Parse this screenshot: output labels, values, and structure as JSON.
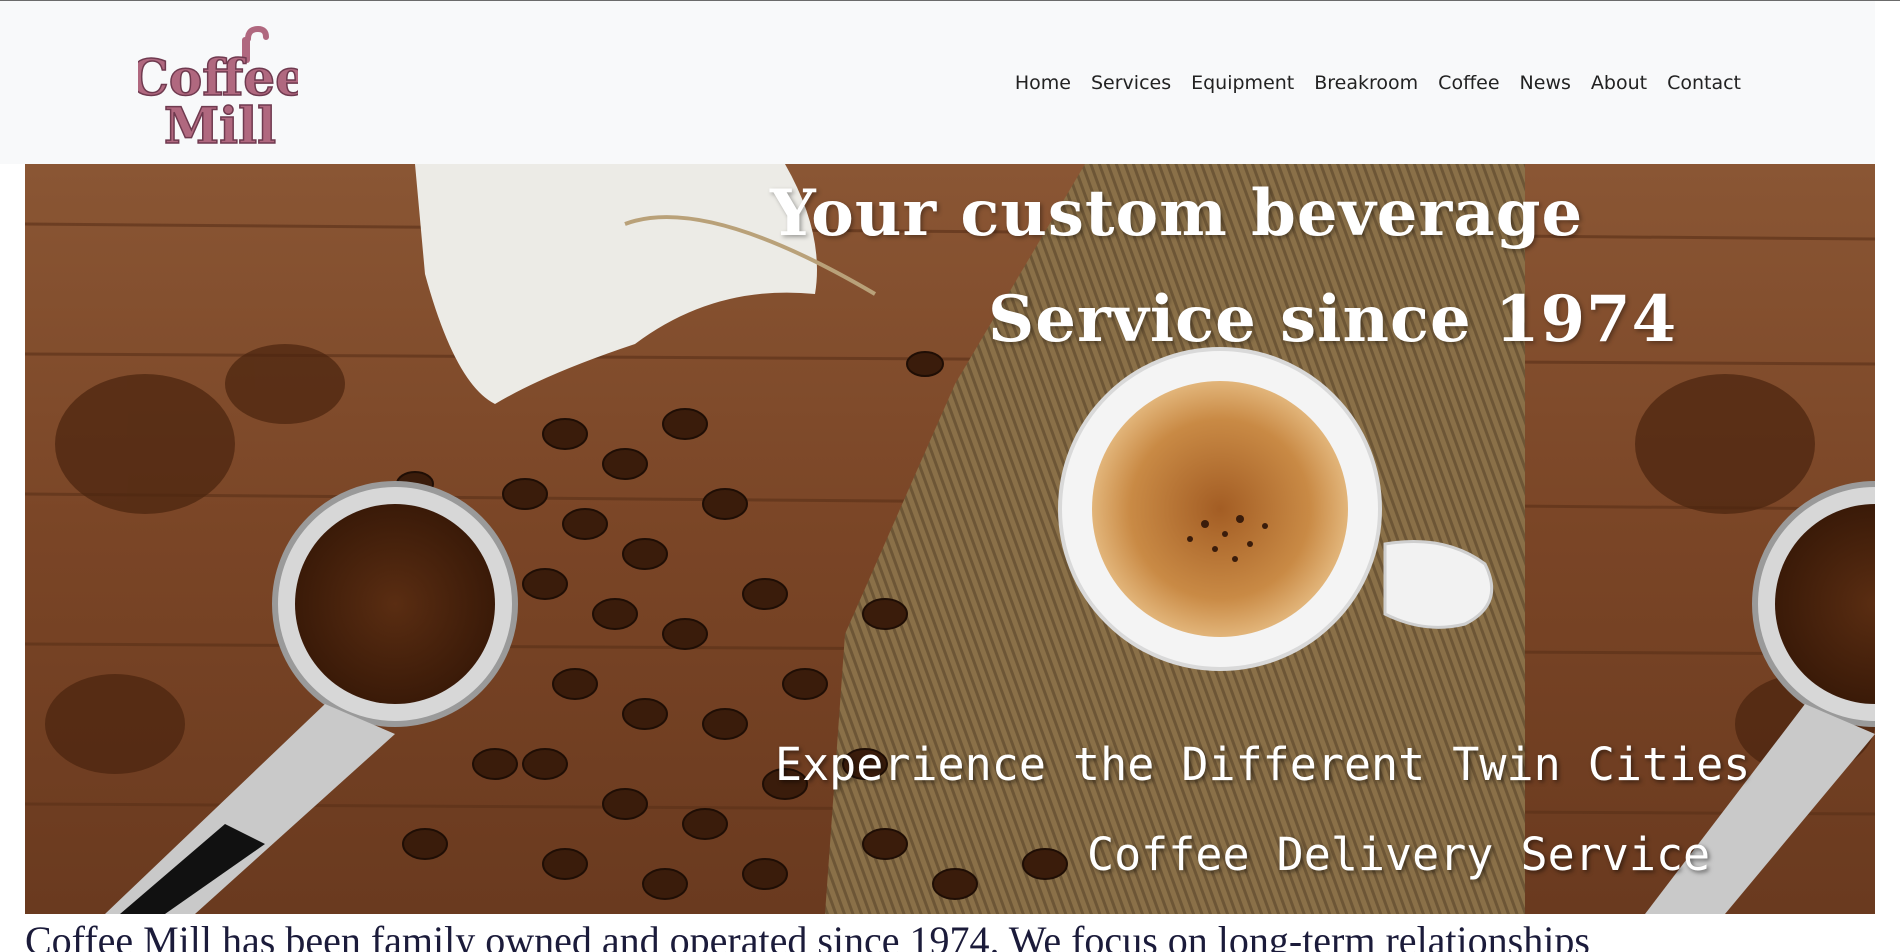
{
  "brand": {
    "logo_line1": "Coffee",
    "logo_line2": "Mill",
    "logo_color": "#b0687f"
  },
  "nav": {
    "items": [
      "Home",
      "Services",
      "Equipment",
      "Breakroom",
      "Coffee",
      "News",
      "About",
      "Contact"
    ]
  },
  "hero": {
    "headline_line1": "Your custom beverage",
    "headline_line2": "Service since 1974",
    "sub_line1": "Experience the Different Twin Cities",
    "sub_line2": "Coffee Delivery Service"
  },
  "intro": {
    "text": "Coffee Mill has been family owned and operated since 1974. We focus on long-term relationships"
  },
  "colors": {
    "navbar_bg": "#f8f9fa",
    "text_dark": "#222222",
    "intro_text": "#1b1b3a"
  }
}
